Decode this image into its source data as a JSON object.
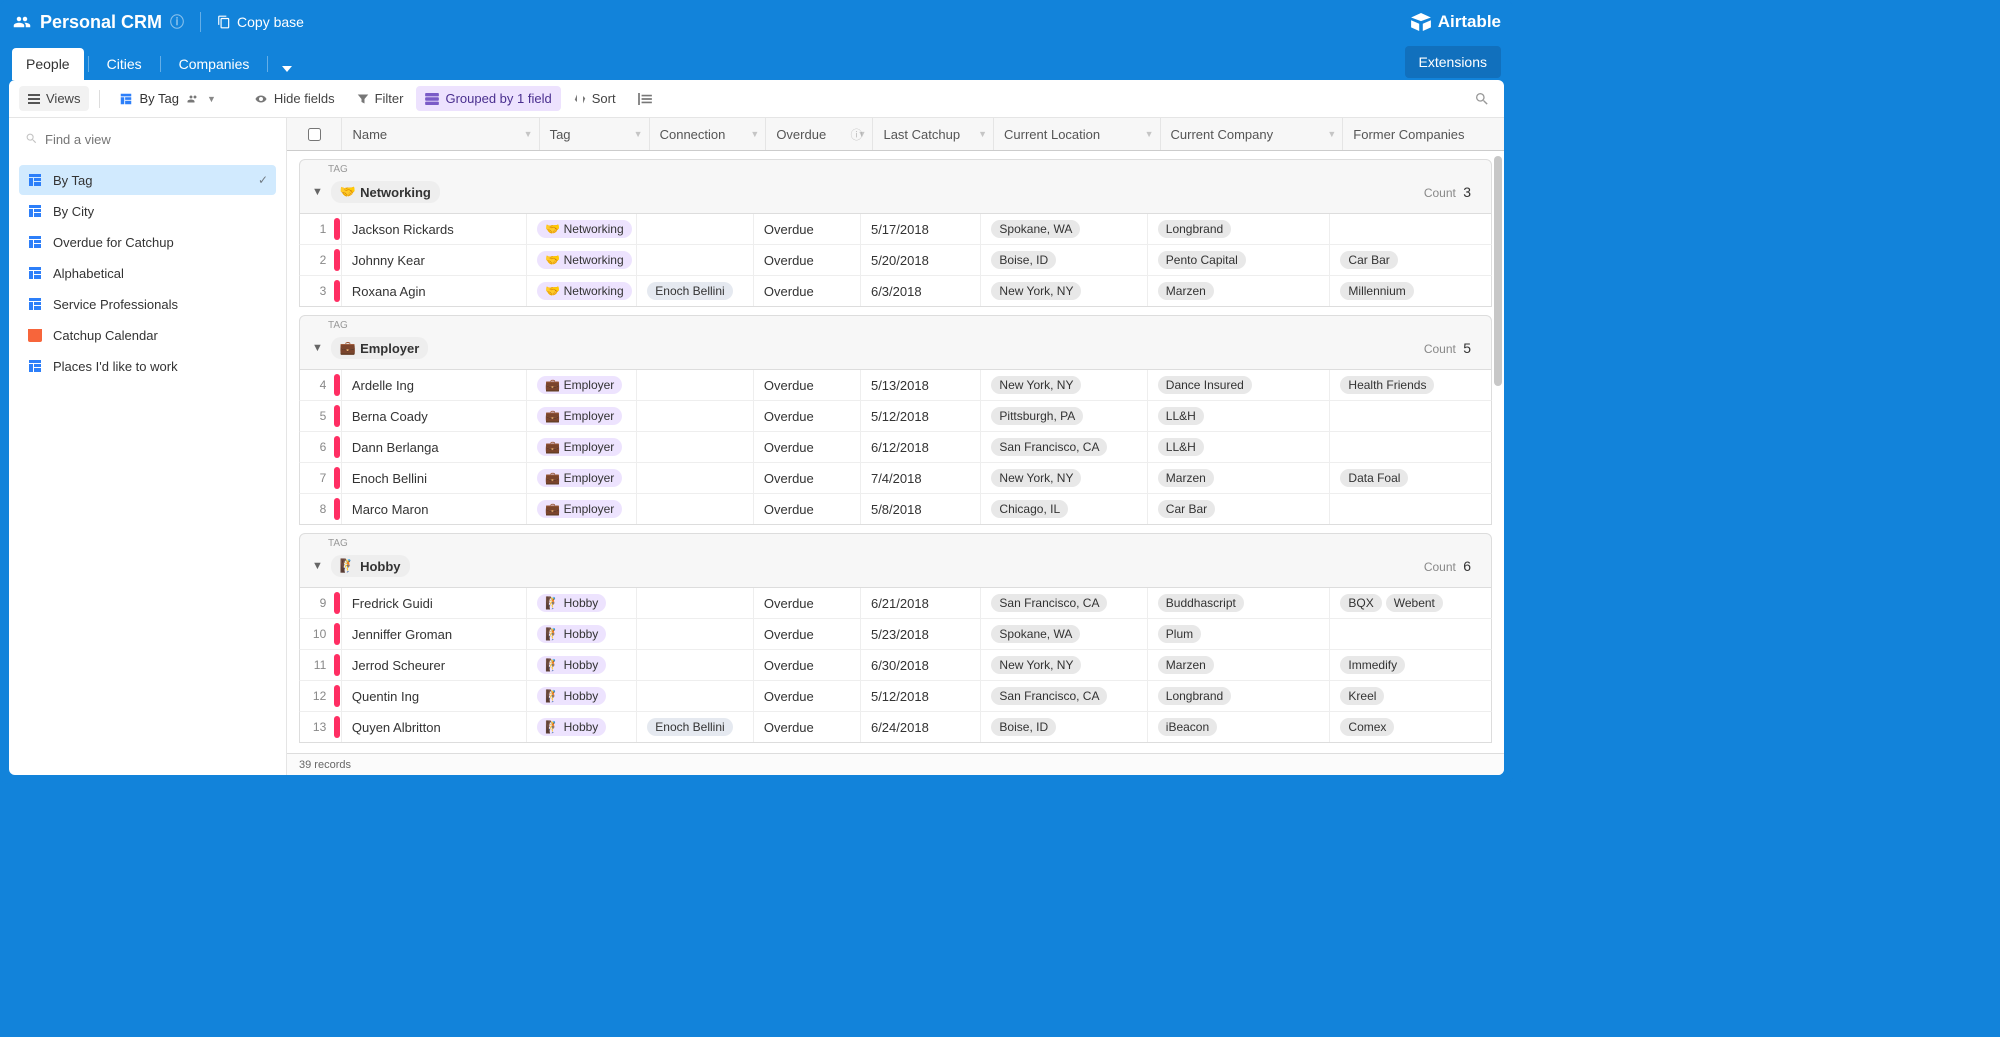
{
  "header": {
    "title": "Personal CRM",
    "copy_base": "Copy base",
    "brand": "Airtable"
  },
  "tabs": {
    "items": [
      "People",
      "Cities",
      "Companies"
    ],
    "active": 0,
    "extensions": "Extensions"
  },
  "toolbar": {
    "views": "Views",
    "current_view": "By Tag",
    "hide_fields": "Hide fields",
    "filter": "Filter",
    "grouped": "Grouped by 1 field",
    "sort": "Sort"
  },
  "sidebar": {
    "find_placeholder": "Find a view",
    "items": [
      {
        "label": "By Tag",
        "type": "grid",
        "active": true
      },
      {
        "label": "By City",
        "type": "grid"
      },
      {
        "label": "Overdue for Catchup",
        "type": "grid"
      },
      {
        "label": "Alphabetical",
        "type": "grid"
      },
      {
        "label": "Service Professionals",
        "type": "grid"
      },
      {
        "label": "Catchup Calendar",
        "type": "cal"
      },
      {
        "label": "Places I'd like to work",
        "type": "grid"
      }
    ]
  },
  "columns": [
    "Name",
    "Tag",
    "Connection",
    "Overdue",
    "Last Catchup",
    "Current Location",
    "Current Company",
    "Former Companies"
  ],
  "tag_field_label": "TAG",
  "count_label": "Count",
  "groups": [
    {
      "tag_emoji": "🤝",
      "tag": "Networking",
      "count": 3,
      "rows": [
        {
          "n": 1,
          "name": "Jackson Rickards",
          "tag": "Networking",
          "conn": "",
          "overdue": "Overdue",
          "last": "5/17/2018",
          "loc": "Spokane, WA",
          "comp": "Longbrand",
          "former": []
        },
        {
          "n": 2,
          "name": "Johnny Kear",
          "tag": "Networking",
          "conn": "",
          "overdue": "Overdue",
          "last": "5/20/2018",
          "loc": "Boise, ID",
          "comp": "Pento Capital",
          "former": [
            "Car Bar"
          ]
        },
        {
          "n": 3,
          "name": "Roxana Agin",
          "tag": "Networking",
          "conn": "Enoch Bellini",
          "overdue": "Overdue",
          "last": "6/3/2018",
          "loc": "New York, NY",
          "comp": "Marzen",
          "former": [
            "Millennium"
          ]
        }
      ]
    },
    {
      "tag_emoji": "💼",
      "tag": "Employer",
      "count": 5,
      "rows": [
        {
          "n": 4,
          "name": "Ardelle Ing",
          "tag": "Employer",
          "conn": "",
          "overdue": "Overdue",
          "last": "5/13/2018",
          "loc": "New York, NY",
          "comp": "Dance Insured",
          "former": [
            "Health Friends"
          ]
        },
        {
          "n": 5,
          "name": "Berna Coady",
          "tag": "Employer",
          "conn": "",
          "overdue": "Overdue",
          "last": "5/12/2018",
          "loc": "Pittsburgh, PA",
          "comp": "LL&H",
          "former": []
        },
        {
          "n": 6,
          "name": "Dann Berlanga",
          "tag": "Employer",
          "conn": "",
          "overdue": "Overdue",
          "last": "6/12/2018",
          "loc": "San Francisco, CA",
          "comp": "LL&H",
          "former": []
        },
        {
          "n": 7,
          "name": "Enoch Bellini",
          "tag": "Employer",
          "conn": "",
          "overdue": "Overdue",
          "last": "7/4/2018",
          "loc": "New York, NY",
          "comp": "Marzen",
          "former": [
            "Data Foal"
          ]
        },
        {
          "n": 8,
          "name": "Marco Maron",
          "tag": "Employer",
          "conn": "",
          "overdue": "Overdue",
          "last": "5/8/2018",
          "loc": "Chicago, IL",
          "comp": "Car Bar",
          "former": []
        }
      ]
    },
    {
      "tag_emoji": "🧗",
      "tag": "Hobby",
      "count": 6,
      "rows": [
        {
          "n": 9,
          "name": "Fredrick Guidi",
          "tag": "Hobby",
          "conn": "",
          "overdue": "Overdue",
          "last": "6/21/2018",
          "loc": "San Francisco, CA",
          "comp": "Buddhascript",
          "former": [
            "BQX",
            "Webent"
          ]
        },
        {
          "n": 10,
          "name": "Jenniffer Groman",
          "tag": "Hobby",
          "conn": "",
          "overdue": "Overdue",
          "last": "5/23/2018",
          "loc": "Spokane, WA",
          "comp": "Plum",
          "former": []
        },
        {
          "n": 11,
          "name": "Jerrod Scheurer",
          "tag": "Hobby",
          "conn": "",
          "overdue": "Overdue",
          "last": "6/30/2018",
          "loc": "New York, NY",
          "comp": "Marzen",
          "former": [
            "Immedify"
          ]
        },
        {
          "n": 12,
          "name": "Quentin Ing",
          "tag": "Hobby",
          "conn": "",
          "overdue": "Overdue",
          "last": "5/12/2018",
          "loc": "San Francisco, CA",
          "comp": "Longbrand",
          "former": [
            "Kreel"
          ]
        },
        {
          "n": 13,
          "name": "Quyen Albritton",
          "tag": "Hobby",
          "conn": "Enoch Bellini",
          "overdue": "Overdue",
          "last": "6/24/2018",
          "loc": "Boise, ID",
          "comp": "iBeacon",
          "former": [
            "Comex"
          ]
        }
      ]
    }
  ],
  "footer": {
    "records": "39 records"
  }
}
